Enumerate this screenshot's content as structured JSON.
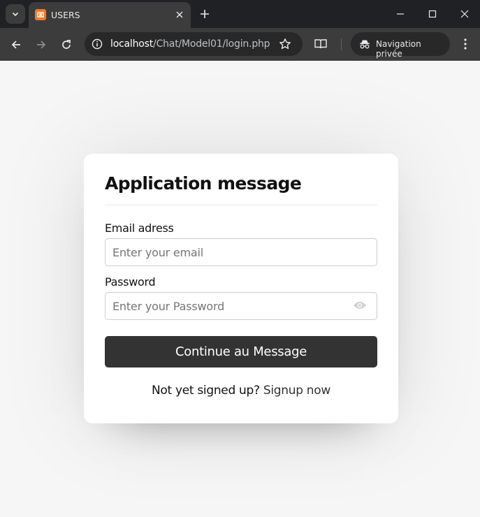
{
  "browser": {
    "tab_title": "USERS",
    "url_host": "localhost",
    "url_path": "/Chat/Model01/login.php",
    "private_label": "Navigation privée",
    "favicon_color": "#f07b2b",
    "icons": [
      "tab-search-icon",
      "favicon-icon",
      "close-icon",
      "plus-icon",
      "minimize-icon",
      "maximize-icon",
      "close-window-icon",
      "back-arrow-icon",
      "forward-arrow-icon",
      "reload-icon",
      "info-icon",
      "star-icon",
      "reader-mode-icon",
      "incognito-icon",
      "kebab-menu-icon"
    ]
  },
  "login": {
    "title": "Application message",
    "email_label": "Email adress",
    "email_placeholder": "Enter your email",
    "password_label": "Password",
    "password_placeholder": "Enter your Password",
    "submit_label": "Continue au Message",
    "signup_prompt": "Not yet signed up?",
    "signup_link": "Signup now",
    "accent_color": "#333333"
  }
}
